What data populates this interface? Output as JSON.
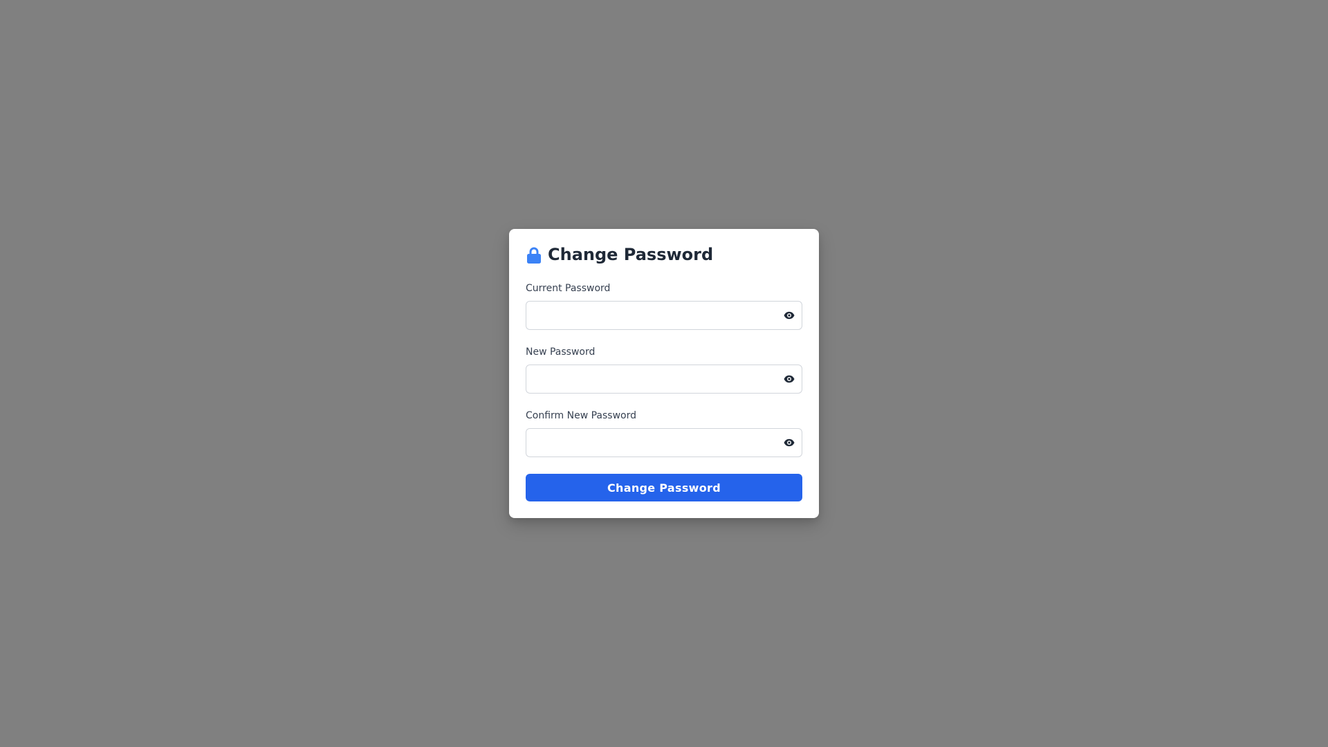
{
  "dialog": {
    "title": "Change Password",
    "title_icon": "lock-icon",
    "accent_color": "#2563eb"
  },
  "fields": [
    {
      "label": "Current Password",
      "value": "",
      "placeholder": "",
      "toggle_icon": "eye-icon"
    },
    {
      "label": "New Password",
      "value": "",
      "placeholder": "",
      "toggle_icon": "eye-icon"
    },
    {
      "label": "Confirm New Password",
      "value": "",
      "placeholder": "",
      "toggle_icon": "eye-icon"
    }
  ],
  "submit": {
    "label": "Change Password",
    "color": "#2563eb"
  }
}
